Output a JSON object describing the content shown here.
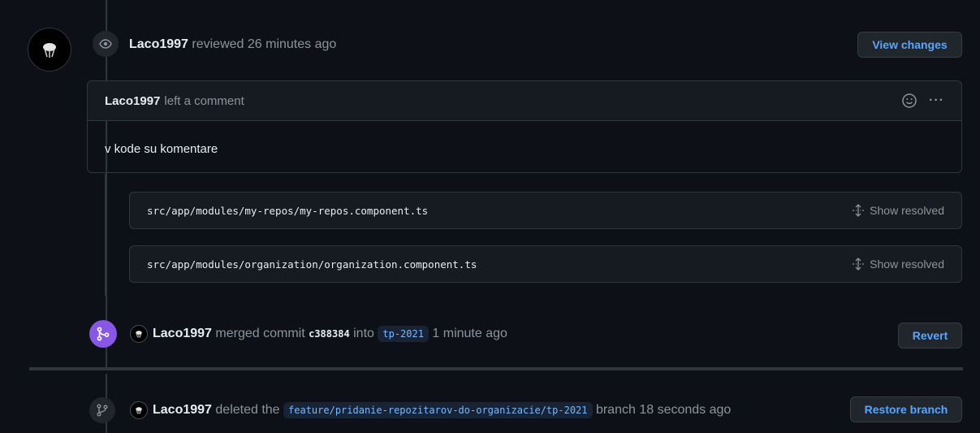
{
  "review": {
    "user": "Laco1997",
    "action": "reviewed 26 minutes ago",
    "view_changes_label": "View changes"
  },
  "comment": {
    "user": "Laco1997",
    "action": "left a comment",
    "body": "v kode su komentare",
    "more_label": "···"
  },
  "files": [
    {
      "path": "src/app/modules/my-repos/my-repos.component.ts",
      "action_label": "Show resolved"
    },
    {
      "path": "src/app/modules/organization/organization.component.ts",
      "action_label": "Show resolved"
    }
  ],
  "merge": {
    "user": "Laco1997",
    "verb": "merged commit",
    "sha": "c388384",
    "into": "into",
    "branch": "tp-2021",
    "time": "1 minute ago",
    "revert_label": "Revert"
  },
  "delete": {
    "user": "Laco1997",
    "verb": "deleted the",
    "branch": "feature/pridanie-repozitarov-do-organizacie/tp-2021",
    "suffix": "branch 18 seconds ago",
    "restore_label": "Restore branch"
  },
  "colors": {
    "accent": "#58a6ff",
    "merged": "#8957e5",
    "background": "#0d1117"
  }
}
